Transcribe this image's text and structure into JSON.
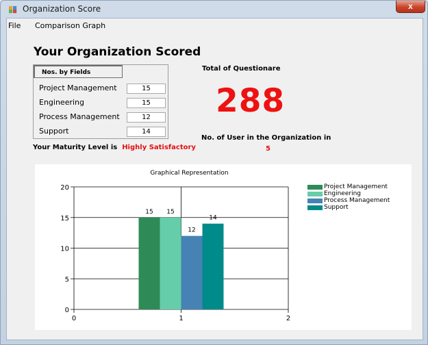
{
  "window": {
    "title": "Organization Score",
    "close_label": "x"
  },
  "menu": [
    {
      "label": "File"
    },
    {
      "label": "Comparison Graph"
    }
  ],
  "heading": "Your Organization Scored",
  "fields": {
    "header": "Nos. by Fields",
    "rows": [
      {
        "label": "Project Management",
        "value": "15"
      },
      {
        "label": "Engineering",
        "value": "15"
      },
      {
        "label": "Process Management",
        "value": "12"
      },
      {
        "label": "Support",
        "value": "14"
      }
    ]
  },
  "maturity": {
    "label": "Your Maturity Level is",
    "value": "Highly Satisfactory"
  },
  "total": {
    "label": "Total of Questionare",
    "value": "288"
  },
  "users": {
    "label": "No. of User in the Organization in",
    "value": "5"
  },
  "colors": {
    "accent_red": "#ee1111"
  },
  "chart_data": {
    "type": "bar",
    "title": "Graphical Representation",
    "categories": [
      "Project Management",
      "Engineering",
      "Process Management",
      "Support"
    ],
    "series": [
      {
        "name": "Project Management",
        "values": [
          15
        ],
        "color": "#2e8b57"
      },
      {
        "name": "Engineering",
        "values": [
          15
        ],
        "color": "#66cdaa"
      },
      {
        "name": "Process Management",
        "values": [
          12
        ],
        "color": "#4682b4"
      },
      {
        "name": "Support",
        "values": [
          14
        ],
        "color": "#008b8b"
      }
    ],
    "data_labels": [
      "15",
      "15",
      "12",
      "14"
    ],
    "ylim": [
      0,
      20
    ],
    "yticks": [
      "0",
      "5",
      "10",
      "15",
      "20"
    ],
    "xlim": [
      0,
      2
    ],
    "xticks": [
      "0",
      "1",
      "2"
    ],
    "grid": true,
    "legend_position": "right"
  }
}
